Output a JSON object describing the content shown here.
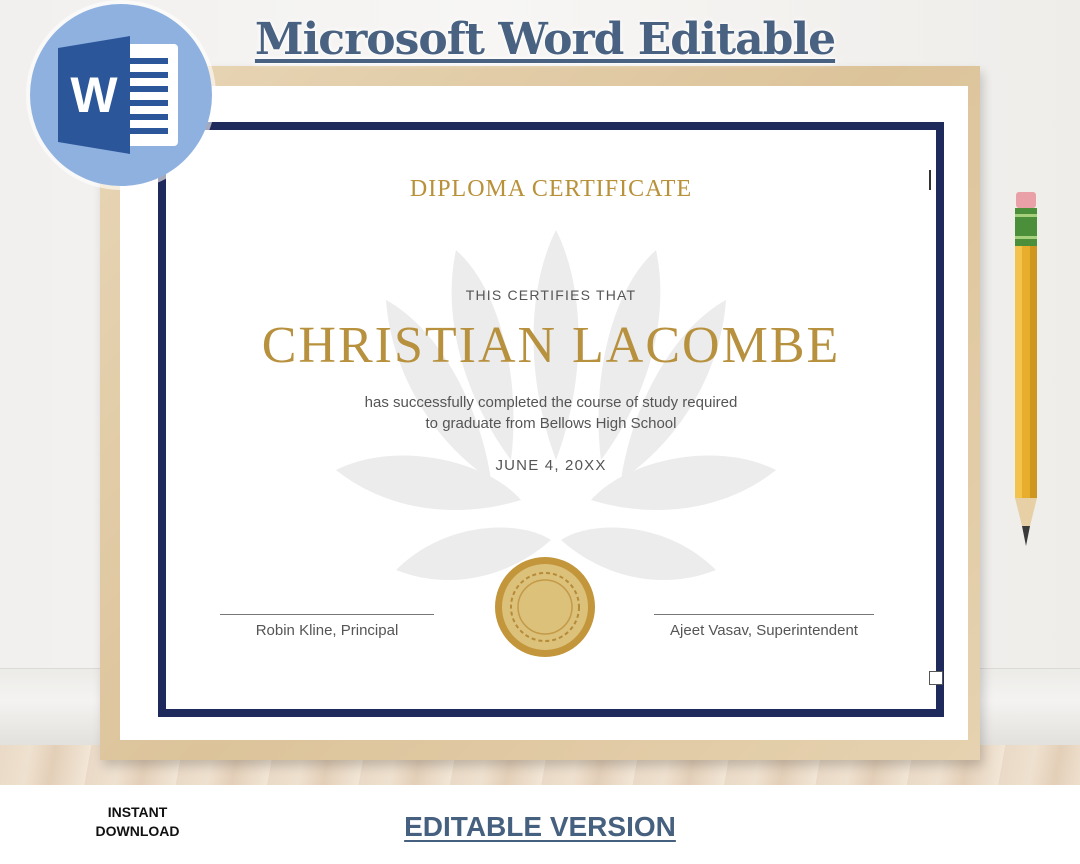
{
  "banner": {
    "title": "Microsoft Word Editable",
    "app_icon_letter": "W"
  },
  "certificate": {
    "heading": "DIPLOMA CERTIFICATE",
    "certifies_text": "THIS CERTIFIES THAT",
    "recipient_name": "CHRISTIAN LACOMBE",
    "course_line_1": "has successfully completed the course of study required",
    "course_line_2": "to graduate from Bellows High School",
    "date": "JUNE 4, 20XX",
    "signature_left": "Robin Kline, Principal",
    "signature_right": "Ajeet Vasav, Superintendent"
  },
  "footer": {
    "instant_line_1": "INSTANT",
    "instant_line_2": "DOWNLOAD",
    "editable_label": "EDITABLE VERSION"
  },
  "colors": {
    "border_navy": "#1f2a5c",
    "gold": "#b8913f",
    "banner_blue": "#4a6282",
    "word_blue": "#2b579a",
    "circle_blue": "#8fb1e0"
  },
  "icons": [
    "word-app-icon",
    "seal-icon",
    "laurel-watermark-icon",
    "pencil-icon"
  ]
}
